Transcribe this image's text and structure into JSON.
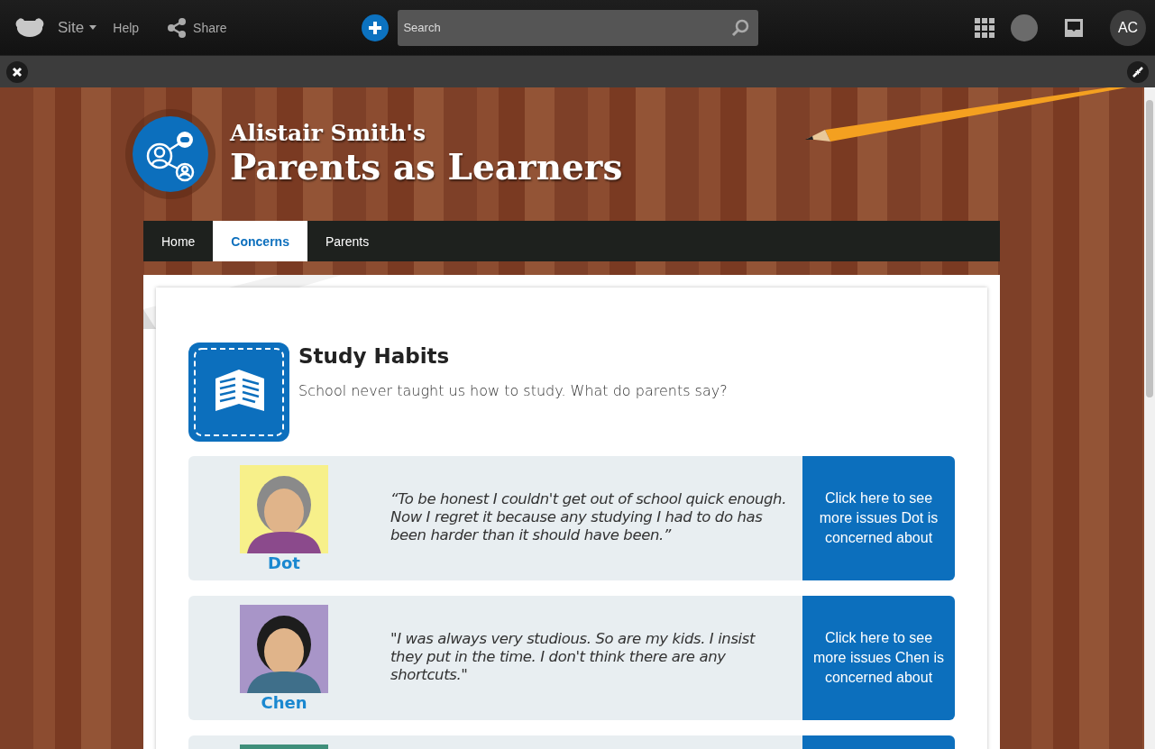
{
  "topbar": {
    "site_menu": "Site",
    "help": "Help",
    "share": "Share",
    "search": {
      "placeholder": "Search"
    },
    "user_initials": "AC"
  },
  "header": {
    "owner": "Alistair Smith's",
    "title": "Parents as Learners"
  },
  "tabs": [
    {
      "label": "Home",
      "selected": false
    },
    {
      "label": "Concerns",
      "selected": true
    },
    {
      "label": "Parents",
      "selected": false
    }
  ],
  "topic": {
    "title": "Study Habits",
    "subtitle": "School never taught us how to study. What do parents say?"
  },
  "parents": [
    {
      "name": "Dot",
      "quote": "“To be honest I couldn't get out of school quick enough. Now I regret it because any studying I had to do has been harder than it should have been.”",
      "link": "Click here to see more issues Dot is concerned about",
      "avatar": {
        "kind": "picture"
      }
    },
    {
      "name": "Chen",
      "quote": "\"I was always very studious. So are my kids. I insist they put in the time. I don't think there are any shortcuts.\"",
      "link": "Click here to see more issues Chen is concerned about",
      "avatar": {
        "kind": "picture"
      }
    },
    {
      "avatar": {
        "kind": "picture"
      }
    }
  ]
}
